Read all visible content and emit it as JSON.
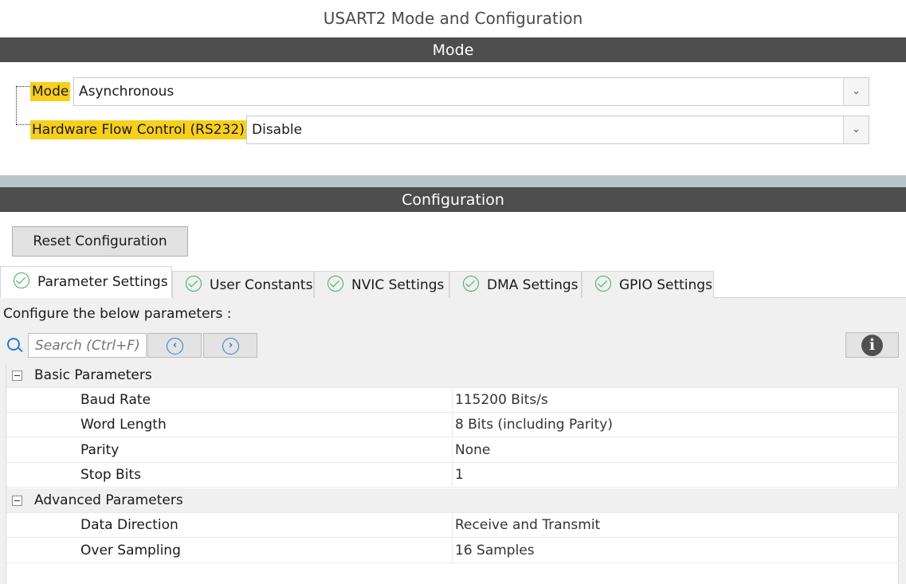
{
  "title": "USART2 Mode and Configuration",
  "mode_section": {
    "header": "Mode",
    "mode_label": "Mode",
    "mode_value": "Asynchronous",
    "hfc_label": "Hardware Flow Control (RS232)",
    "hfc_value": "Disable"
  },
  "config_section": {
    "header": "Configuration",
    "reset_label": "Reset Configuration",
    "tabs": [
      {
        "label": "Parameter Settings",
        "active": true
      },
      {
        "label": "User Constants"
      },
      {
        "label": "NVIC Settings"
      },
      {
        "label": "DMA Settings"
      },
      {
        "label": "GPIO Settings"
      }
    ],
    "caption": "Configure the below parameters :",
    "search_placeholder": "Search (Ctrl+F)",
    "groups": [
      {
        "label": "Basic Parameters",
        "params": [
          {
            "name": "Baud Rate",
            "value": "115200 Bits/s"
          },
          {
            "name": "Word Length",
            "value": "8 Bits (including Parity)"
          },
          {
            "name": "Parity",
            "value": "None"
          },
          {
            "name": "Stop Bits",
            "value": "1"
          }
        ]
      },
      {
        "label": "Advanced Parameters",
        "params": [
          {
            "name": "Data Direction",
            "value": "Receive and Transmit"
          },
          {
            "name": "Over Sampling",
            "value": "16 Samples"
          }
        ]
      }
    ]
  },
  "icons": {
    "tab_status": "check-circle-icon",
    "search": "search-icon",
    "prev": "chevron-left-circle-icon",
    "next": "chevron-right-circle-icon",
    "info": "info-icon",
    "collapse": "minus-box-icon",
    "dropdown": "chevron-down-icon"
  },
  "colors": {
    "section_header_bg": "#4d4d4d",
    "label_highlight": "#f7cf1d",
    "check_green": "#42a96a",
    "accent_blue": "#2a7bd0"
  }
}
